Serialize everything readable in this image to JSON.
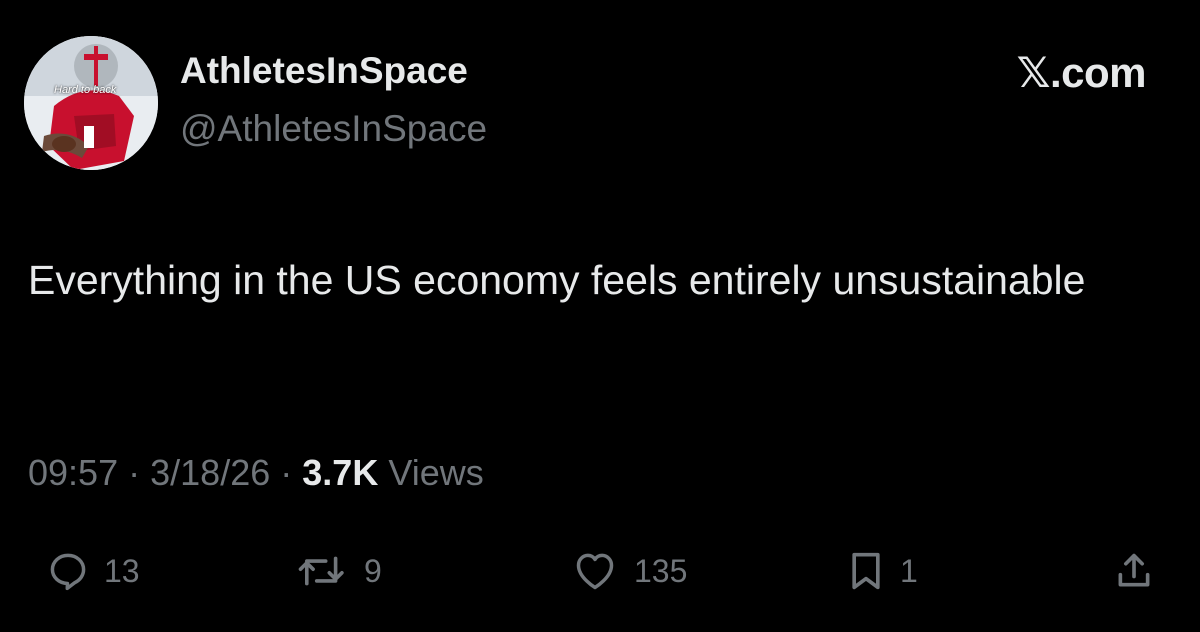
{
  "author": {
    "display_name": "AthletesInSpace",
    "handle": "@AthletesInSpace",
    "avatar_caption": "Hard to back"
  },
  "brand": "𝕏.com",
  "tweet": {
    "text": "Everything in the US economy feels entirely unsustainable"
  },
  "meta": {
    "time": "09:57",
    "separator": "·",
    "date": "3/18/26",
    "views_count": "3.7K",
    "views_label": "Views"
  },
  "actions": {
    "replies": "13",
    "reposts": "9",
    "likes": "135",
    "bookmarks": "1"
  },
  "colors": {
    "background": "#000000",
    "primary_text": "#e7e9ea",
    "secondary_text": "#71767b"
  },
  "icons": [
    "reply-icon",
    "repost-icon",
    "like-icon",
    "bookmark-icon",
    "share-icon"
  ]
}
